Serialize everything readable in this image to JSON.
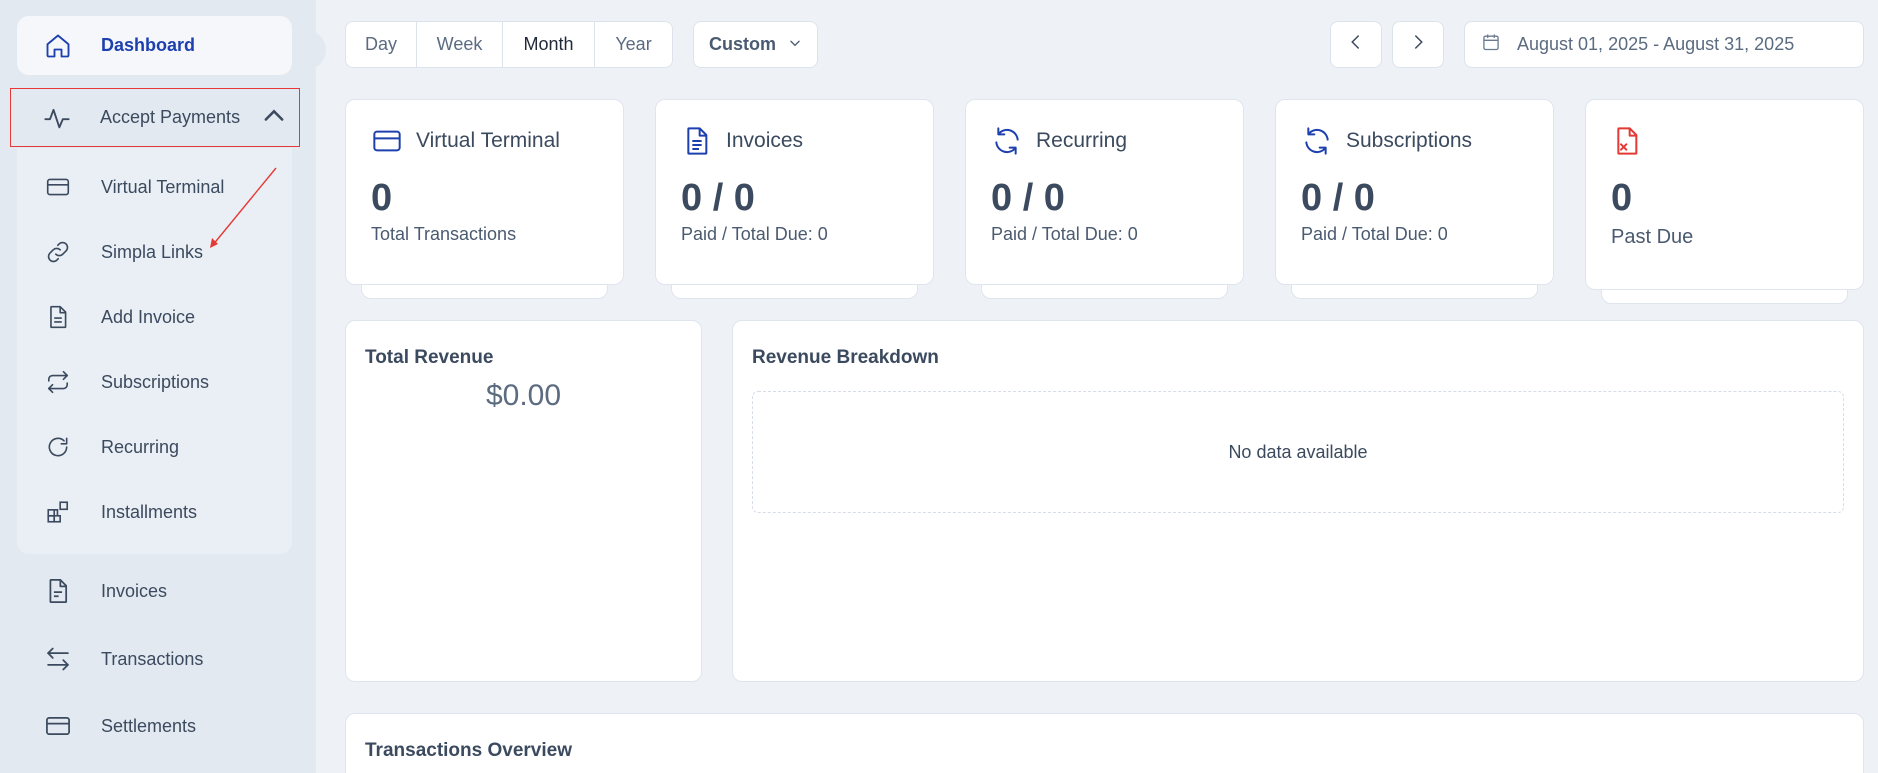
{
  "sidebar": {
    "dashboard": "Dashboard",
    "accept_payments": "Accept Payments",
    "submenu": [
      {
        "label": "Virtual Terminal",
        "icon": "credit-card-icon"
      },
      {
        "label": "Simpla Links",
        "icon": "link-icon"
      },
      {
        "label": "Add Invoice",
        "icon": "document-icon"
      },
      {
        "label": "Subscriptions",
        "icon": "repeat-icon"
      },
      {
        "label": "Recurring",
        "icon": "refresh-icon"
      },
      {
        "label": "Installments",
        "icon": "blocks-icon"
      }
    ],
    "items": [
      {
        "label": "Invoices",
        "icon": "document-icon"
      },
      {
        "label": "Transactions",
        "icon": "arrows-swap-icon"
      },
      {
        "label": "Settlements",
        "icon": "credit-card-icon"
      }
    ]
  },
  "topbar": {
    "periods": [
      "Day",
      "Week",
      "Month",
      "Year"
    ],
    "active_period": "Month",
    "custom_label": "Custom",
    "date_range": "August 01, 2025 - August 31, 2025"
  },
  "cards": [
    {
      "title": "Virtual Terminal",
      "value": "0",
      "subtitle": "Total Transactions",
      "icon": "credit-card-icon",
      "color": "#1e40af"
    },
    {
      "title": "Invoices",
      "value": "0 / 0",
      "subtitle": "Paid / Total Due: 0",
      "icon": "document-icon",
      "color": "#1e40af"
    },
    {
      "title": "Recurring",
      "value": "0 / 0",
      "subtitle": "Paid / Total Due: 0",
      "icon": "refresh-icon",
      "color": "#1e40af"
    },
    {
      "title": "Subscriptions",
      "value": "0 / 0",
      "subtitle": "Paid / Total Due: 0",
      "icon": "refresh-icon",
      "color": "#1e40af"
    },
    {
      "title": "",
      "value": "0",
      "subtitle": "Past Due",
      "icon": "file-x-icon",
      "color": "#e53935"
    }
  ],
  "panels": {
    "total_revenue": {
      "title": "Total Revenue",
      "amount": "$0.00"
    },
    "revenue_breakdown": {
      "title": "Revenue Breakdown",
      "empty": "No data available"
    },
    "transactions_overview": {
      "title": "Transactions Overview"
    }
  },
  "colors": {
    "accent": "#1e40af",
    "danger": "#e53935",
    "background": "#eef2f7",
    "sidebar": "#e3e9f1"
  }
}
